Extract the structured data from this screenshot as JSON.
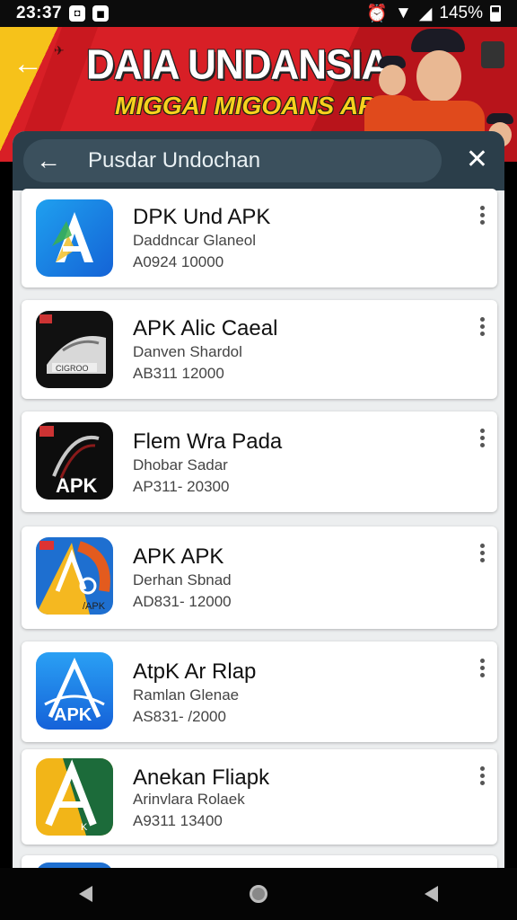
{
  "status": {
    "time": "23:37",
    "battery": "145%",
    "icons": [
      "notification-icon-a",
      "notification-icon-b",
      "alarm-icon",
      "wifi-icon",
      "signal-icon",
      "battery-icon"
    ]
  },
  "banner": {
    "title": "DAIA UNDANSIA",
    "subtitle": "MIGGAI MIGOANS APK"
  },
  "search": {
    "query": "Pusdar Undochan",
    "placeholder": "Pusdar Undochan"
  },
  "apps": [
    {
      "name": "DPK Und APK",
      "developer": "Daddncar Glaneol",
      "meta": "A0924 10000",
      "icon": "A-icon"
    },
    {
      "name": "APK Alic Caeal",
      "developer": "Danven Shardol",
      "meta": "AB311 12000",
      "icon": "gray-cigar-icon"
    },
    {
      "name": "Flem Wra Pada",
      "developer": "Dhobar Sadar",
      "meta": "AP311- 20300",
      "icon": "APK-black-icon"
    },
    {
      "name": "APK APK",
      "developer": "Derhan Sbnad",
      "meta": "AD831- 12000",
      "icon": "yellow-A-icon"
    },
    {
      "name": "AtpK Ar Rlap",
      "developer": "Ramlan Glenae",
      "meta": "AS831- /2000",
      "icon": "blue-APK-icon"
    },
    {
      "name": "Anekan Fliapk",
      "developer": "Arinvlara Rolaek",
      "meta": "A9311 13400",
      "icon": "green-A-icon"
    }
  ],
  "colors": {
    "header": "#2b3e4a",
    "banner_red": "#d81f26",
    "banner_yellow": "#f7d11e"
  }
}
